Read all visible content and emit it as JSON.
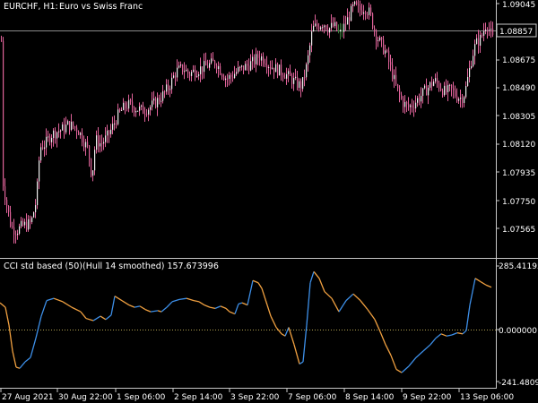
{
  "header": {
    "symbol_timeframe": "EURCHF, H1:",
    "description": "Euro vs Swiss Franc"
  },
  "price_axis": {
    "ticks": [
      "1.09045",
      "1.08857",
      "1.08675",
      "1.08490",
      "1.08305",
      "1.08120",
      "1.07935",
      "1.07750",
      "1.07565"
    ],
    "current_price_label": "1.08857"
  },
  "indicator": {
    "title": "CCI std based (50)(Hull 14 smoothed) 157.673996",
    "axis_ticks": [
      "285.411959",
      "0.000000",
      "-241.480980"
    ]
  },
  "time_axis": {
    "labels": [
      "27 Aug 2021",
      "30 Aug 22:00",
      "1 Sep 06:00",
      "2 Sep 14:00",
      "3 Sep 22:00",
      "7 Sep 06:00",
      "8 Sep 14:00",
      "9 Sep 22:00",
      "13 Sep 06:00"
    ]
  },
  "colors": {
    "background": "#000000",
    "bull_candle": "#3b7a3b",
    "bear_candle": "#e0639a",
    "grid_line": "#8a8a8a",
    "separator": "#c8c8c8",
    "cci_rising": "#3d8fe8",
    "cci_falling": "#f0a040",
    "zero_line": "#b0a050"
  },
  "chart_data": [
    {
      "type": "line",
      "title": "EURCHF, H1: Euro vs Swiss Franc",
      "ylim": [
        1.0745,
        1.091
      ],
      "x": [
        "27 Aug 2021",
        "30 Aug 22:00",
        "1 Sep 06:00",
        "2 Sep 14:00",
        "3 Sep 22:00",
        "7 Sep 06:00",
        "8 Sep 14:00",
        "9 Sep 22:00",
        "13 Sep 06:00"
      ],
      "series": [
        {
          "values": [
            1.076,
            1.0852,
            1.0835,
            1.0862,
            1.0875,
            1.088,
            1.089,
            1.0845,
            1.0886
          ]
        }
      ]
    },
    {
      "type": "line",
      "title": "CCI std based (50)(Hull 14 smoothed) 157.673996",
      "ylim": [
        -241.48098,
        285.411959
      ],
      "x": [
        "27 Aug 2021",
        "30 Aug 22:00",
        "1 Sep 06:00",
        "2 Sep 14:00",
        "3 Sep 22:00",
        "7 Sep 06:00",
        "8 Sep 14:00",
        "9 Sep 22:00",
        "13 Sep 06:00"
      ],
      "series": [
        {
          "values": [
            60,
            -200,
            140,
            60,
            120,
            -110,
            270,
            -160,
            190
          ]
        }
      ]
    }
  ]
}
